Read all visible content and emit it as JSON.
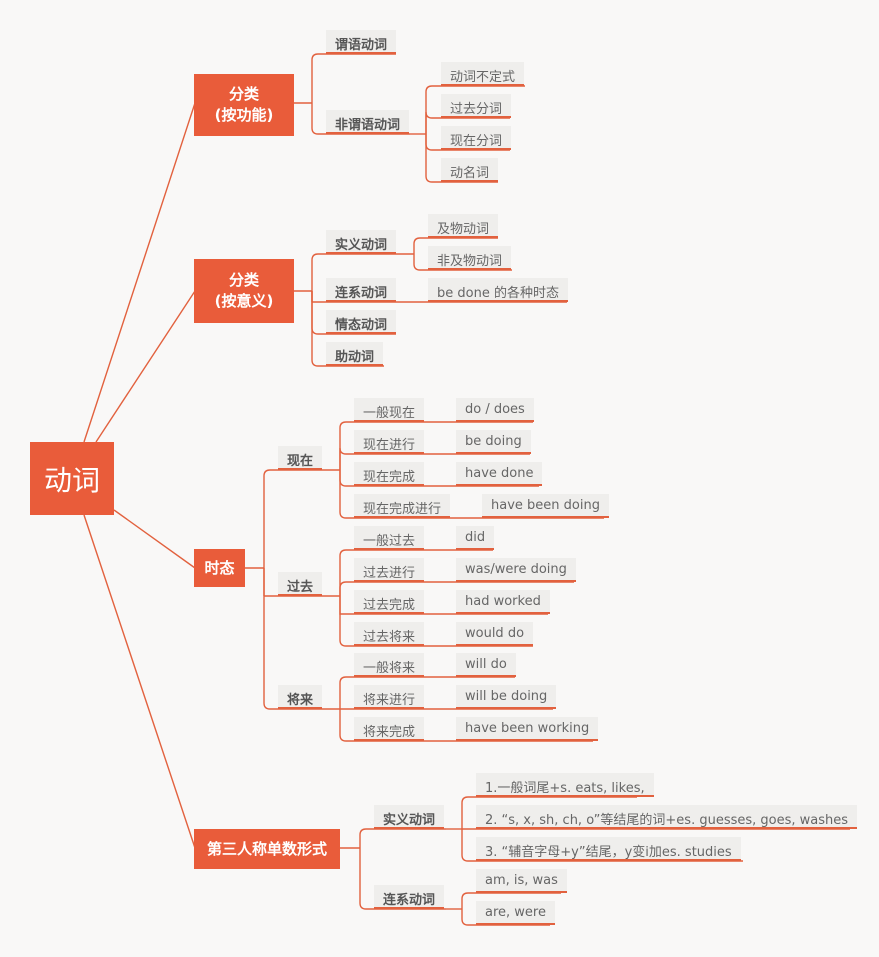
{
  "root": "动词",
  "func": {
    "line1": "分类",
    "line2": "(按功能)",
    "c1": "谓语动词",
    "c2": "非谓语动词",
    "nonfinite": [
      "动词不定式",
      "过去分词",
      "现在分词",
      "动名词"
    ]
  },
  "meaning": {
    "line1": "分类",
    "line2": "(按意义)",
    "c1": "实义动词",
    "c1_children": [
      "及物动词",
      "非及物动词"
    ],
    "c2": "连系动词",
    "c2_child": "be done 的各种时态",
    "c3": "情态动词",
    "c4": "助动词"
  },
  "tense": {
    "label": "时态",
    "present": {
      "label": "现在",
      "rows": [
        {
          "name": "一般现在",
          "form": "do / does"
        },
        {
          "name": "现在进行",
          "form": "be doing"
        },
        {
          "name": "现在完成",
          "form": "have done"
        },
        {
          "name": "现在完成进行",
          "form": "have been doing"
        }
      ]
    },
    "past": {
      "label": "过去",
      "rows": [
        {
          "name": "一般过去",
          "form": "did"
        },
        {
          "name": "过去进行",
          "form": "was/were doing"
        },
        {
          "name": "过去完成",
          "form": "had worked"
        },
        {
          "name": "过去将来",
          "form": "would do"
        }
      ]
    },
    "future": {
      "label": "将来",
      "rows": [
        {
          "name": "一般将来",
          "form": "will do"
        },
        {
          "name": "将来进行",
          "form": "will be doing"
        },
        {
          "name": "将来完成",
          "form": "have been working"
        }
      ]
    }
  },
  "third": {
    "label": "第三人称单数形式",
    "lexical": {
      "label": "实义动词",
      "rules": [
        "1.一般词尾+s. eats, likes,",
        "2. “s, x, sh, ch, o”等结尾的词+es. guesses, goes, washes",
        "3. “辅音字母+y”结尾，y变i加es. studies"
      ]
    },
    "linking": {
      "label": "连系动词",
      "forms": [
        "am, is, was",
        "are, were"
      ]
    }
  }
}
